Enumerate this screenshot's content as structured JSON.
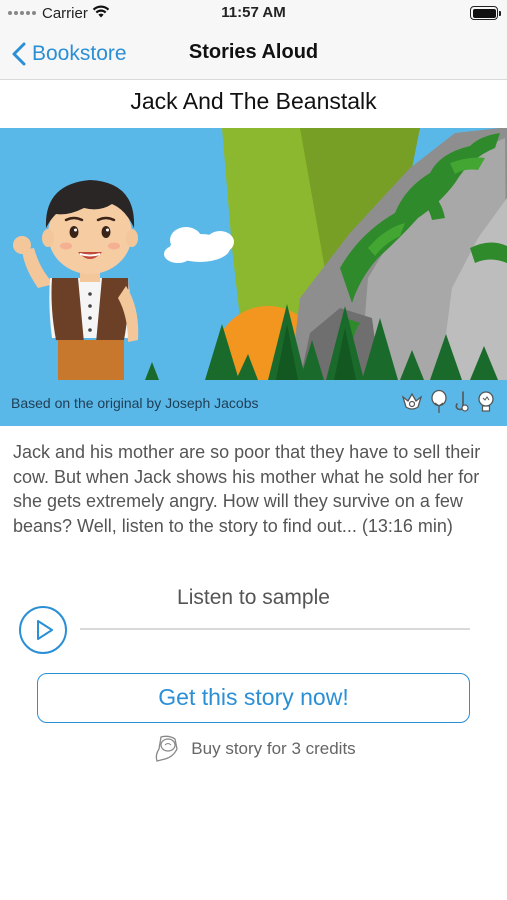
{
  "status_bar": {
    "carrier": "Carrier",
    "time": "11:57 AM",
    "battery_level": 100,
    "wifi_icon": "wifi-icon",
    "battery_icon": "battery-icon"
  },
  "nav": {
    "back_label": "Bookstore",
    "title": "Stories Aloud",
    "back_icon": "chevron-left-icon"
  },
  "story": {
    "title": "Jack And The Beanstalk",
    "caption": "Based on the original by Joseph Jacobs",
    "caption_icons": [
      "ornament-icon",
      "balloon-icon",
      "hook-icon",
      "lightbulb-icon"
    ],
    "description": "Jack and his mother are so poor that they have to sell their cow. But when Jack shows his mother what he sold her for she gets extremely angry. How will they survive on a few beans? Well, listen to the story to find out... (13:16 min)"
  },
  "sample": {
    "label": "Listen to sample",
    "play_icon": "play-icon",
    "progress": 0
  },
  "purchase": {
    "button_label": "Get this story now!",
    "buy_text": "Buy story for 3 credits",
    "credit_icon": "credit-coin-icon"
  },
  "colors": {
    "accent": "#2b8fd6",
    "sky": "#5ab8e8",
    "tree_green": "#1a6b2b",
    "vine_green": "#2e8a2a"
  }
}
